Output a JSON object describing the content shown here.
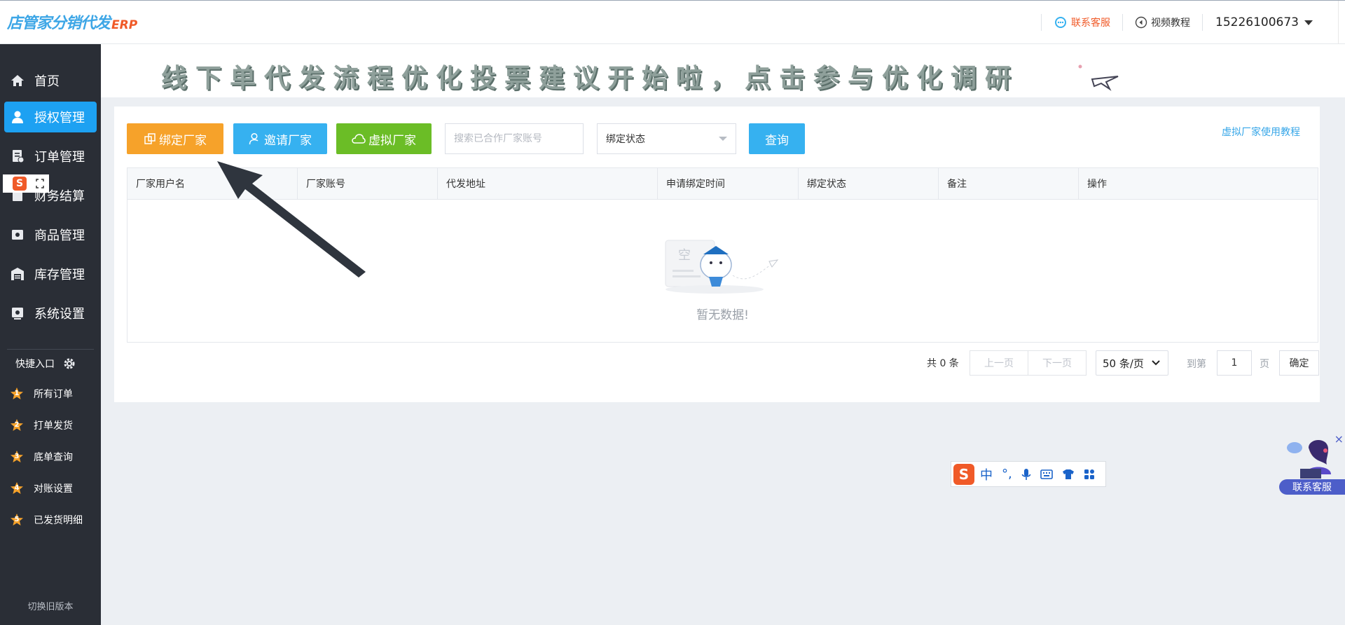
{
  "header": {
    "logo_main": "店管家分销代发",
    "logo_sub": "ERP",
    "contact_service": "联系客服",
    "video_tutorial": "视频教程",
    "user_phone": "15226100673"
  },
  "sidebar": {
    "items": [
      {
        "label": "首页",
        "icon": "home-icon"
      },
      {
        "label": "授权管理",
        "icon": "user-icon",
        "active": true
      },
      {
        "label": "订单管理",
        "icon": "order-icon"
      },
      {
        "label": "财务结算",
        "icon": "finance-icon"
      },
      {
        "label": "商品管理",
        "icon": "product-icon"
      },
      {
        "label": "库存管理",
        "icon": "warehouse-icon"
      },
      {
        "label": "系统设置",
        "icon": "settings-icon"
      }
    ],
    "quick_title": "快捷入口",
    "quick_items": [
      {
        "num": "1",
        "label": "所有订单"
      },
      {
        "num": "2",
        "label": "打单发货"
      },
      {
        "num": "3",
        "label": "底单查询"
      },
      {
        "num": "4",
        "label": "对账设置"
      },
      {
        "num": "5",
        "label": "已发货明细"
      }
    ],
    "switch_old": "切换旧版本"
  },
  "banner": {
    "text": "线下单代发流程优化投票建议开始啦，点击参与优化调研"
  },
  "toolbar": {
    "bind_label": "绑定厂家",
    "invite_label": "邀请厂家",
    "virtual_label": "虚拟厂家",
    "search_placeholder": "搜索已合作厂家账号",
    "status_select": "绑定状态",
    "query_label": "查询",
    "help_link": "虚拟厂家使用教程"
  },
  "table": {
    "columns": [
      "厂家用户名",
      "厂家账号",
      "代发地址",
      "申请绑定时间",
      "绑定状态",
      "备注",
      "操作"
    ],
    "empty_text": "暂无数据!",
    "empty_glyph": "空"
  },
  "pagination": {
    "total": "共 0 条",
    "prev": "上一页",
    "next": "下一页",
    "page_size": "50 条/页",
    "goto_label": "到第",
    "current_page": "1",
    "page_unit": "页",
    "confirm": "确定"
  },
  "ime": {
    "mode": "中",
    "punct": "°,",
    "logo": "S"
  },
  "floating_service": {
    "label": "联系客服",
    "close": "×"
  },
  "colors": {
    "accent_blue": "#36b1f0",
    "active_nav": "#1da1f2",
    "bind_orange": "#f6a22a",
    "virtual_green": "#6bbd26",
    "sidebar_bg": "#2a2e36"
  }
}
